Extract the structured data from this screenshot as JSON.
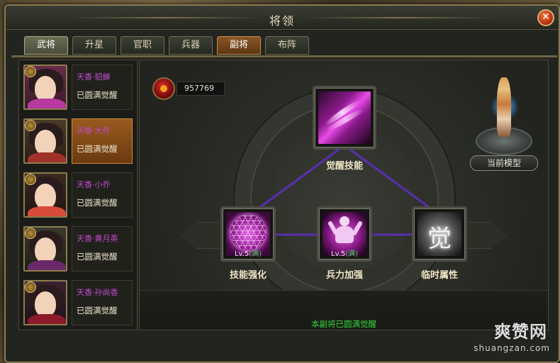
{
  "window": {
    "title": "将领"
  },
  "tabs": [
    {
      "label": "武将"
    },
    {
      "label": "升星"
    },
    {
      "label": "官职"
    },
    {
      "label": "兵器"
    },
    {
      "label": "副将"
    },
    {
      "label": "布阵"
    }
  ],
  "heroes": [
    {
      "name": "天香·貂蝉",
      "status": "已圆满觉醒"
    },
    {
      "name": "天香·大乔",
      "status": "已圆满觉醒"
    },
    {
      "name": "天香·小乔",
      "status": "已圆满觉醒"
    },
    {
      "name": "天香·黄月英",
      "status": "已圆满觉醒"
    },
    {
      "name": "天香·孙尚香",
      "status": "已圆满觉醒"
    }
  ],
  "currency": {
    "value": "957769"
  },
  "skills": {
    "awaken": {
      "label": "觉醒技能"
    },
    "skill_enhance": {
      "label": "技能强化",
      "level": "Lv.5",
      "full": "(满)"
    },
    "troop_boost": {
      "label": "兵力加强",
      "level": "Lv.5",
      "full": "(满)"
    },
    "temp_attr": {
      "label": "临时属性",
      "glyph": "觉"
    }
  },
  "model": {
    "button_label": "当前模型"
  },
  "status_message": "本副将已圆满觉醒",
  "watermark": {
    "brand": "爽赞网",
    "url": "shuangzan.com"
  },
  "colors": {
    "hero_name": "#c34acf",
    "status_green": "#36d43a",
    "selected_bg": "#9a5a1e",
    "link_line": "#5a2fb0"
  },
  "icons": {
    "close": "close-icon",
    "currency": "gem-icon"
  }
}
